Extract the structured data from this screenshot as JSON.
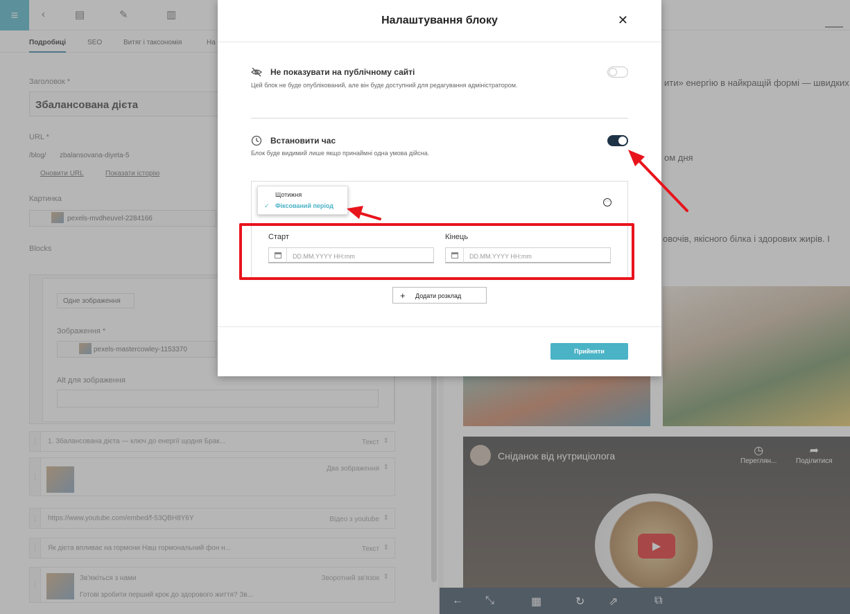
{
  "app": {
    "tabs": [
      "Подробиці",
      "SEO",
      "Витяг і таксономія",
      "На"
    ],
    "fields": {
      "title_label": "Заголовок *",
      "title_value": "Збалансована дієта",
      "url_label": "URL *",
      "url_prefix": "/blog/",
      "url_value": "zbalansovana-diyeta-5",
      "url_update": "Оновити URL",
      "show_history": "Показати історію",
      "image_label": "Картинка",
      "image_value": "pexels-mvdheuvel-2284166",
      "blocks_label": "Blocks",
      "image_mode": "Одне зображення",
      "images_label": "Зображення *",
      "images_value": "pexels-mastercowley-1153370",
      "alt_label": "Alt для зображення"
    },
    "block_items": [
      {
        "text": "1. Збалансована дієта — ключ до енергії щодня Брак...",
        "type": "Текст"
      },
      {
        "text": "",
        "type": "Два зображення"
      },
      {
        "text": "https://www.youtube.com/embed/f-53QBH8Y6Y",
        "type": "Відео з youtube"
      },
      {
        "text": "Як дієта впливає на гормони Наш гормональний фон н...",
        "type": "Текст"
      },
      {
        "text": "Зв'яжіться з нами",
        "type": "Зворотний зв'язок",
        "sub": "Готові зробити перший крок до здорового життя? Зв..."
      }
    ],
    "preview": {
      "line1": "ити» енергію в найкращій формі — швидких",
      "line2": "ом дня",
      "line3": "овочів, якісного білка і здорових жирів. І",
      "video_title": "Сніданок від нутриціолога",
      "video_watch": "Переглян...",
      "video_share": "Поділитися"
    }
  },
  "modal": {
    "title": "Налаштування блоку",
    "hide_option": {
      "title": "Не показувати на публічному сайті",
      "description": "Цей блок не буде опублікований, але він буде доступний для редагування адміністратором.",
      "enabled": false
    },
    "time_option": {
      "title": "Встановити час",
      "description": "Блок буде видимий лише якщо принаймні одна умова дійсна.",
      "enabled": true
    },
    "schedule_dropdown": {
      "options": [
        "Щотижня",
        "Фіксований період"
      ],
      "selected": "Фіксований період",
      "check": "✓"
    },
    "start_label": "Старт",
    "end_label": "Кінець",
    "start_placeholder": "DD.MM.YYYY HH:mm",
    "end_placeholder": "DD.MM.YYYY HH:mm",
    "add_schedule": "Додати розклад",
    "accept": "Прийняти",
    "more_glyph": "···",
    "close_glyph": "✕",
    "plus_glyph": "+"
  },
  "icons": {
    "hide": "eye-slash-icon",
    "time": "clock-icon",
    "calendar": "calendar-icon"
  },
  "colors": {
    "accent": "#4ab3c6",
    "toggle_on": "#1f3346",
    "annotation_red": "#e8141c"
  }
}
